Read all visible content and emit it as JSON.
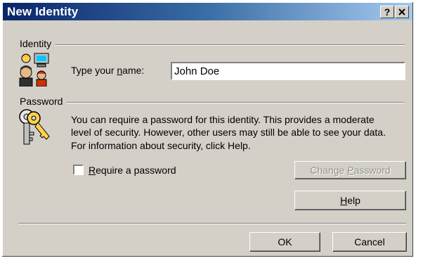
{
  "dialog": {
    "title": "New Identity",
    "help_button": "?",
    "close_button": "×"
  },
  "identity": {
    "group_label": "Identity",
    "name_label_pre": "Type your ",
    "name_label_accel": "n",
    "name_label_post": "ame:",
    "name_value": "John Doe",
    "icon": "people-computer-icon"
  },
  "password": {
    "group_label": "Password",
    "icon": "keys-icon",
    "description_line1": "You can require a password for this identity.  This provides a moderate",
    "description_line2": "level of security. However, other users may still be able to see your data.",
    "description_line3": "For information about security, click Help.",
    "require_label_accel": "R",
    "require_label_rest": "equire a password",
    "require_checked": false,
    "change_pre": "Change ",
    "change_accel": "P",
    "change_post": "assword",
    "help_accel": "H",
    "help_rest": "elp"
  },
  "footer": {
    "ok_label": "OK",
    "cancel_label": "Cancel"
  }
}
